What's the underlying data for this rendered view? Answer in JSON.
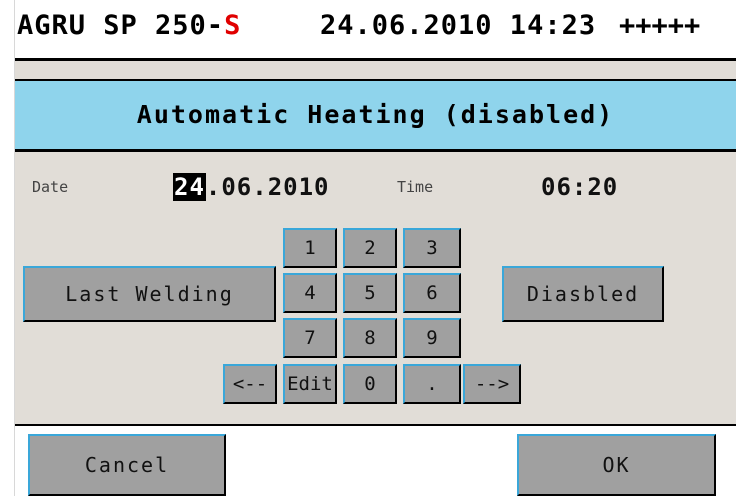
{
  "header": {
    "model_prefix": "AGRU SP 250-",
    "model_suffix": "S",
    "datetime": "24.06.2010 14:23",
    "signal": "+++++"
  },
  "screen": {
    "title": "Automatic Heating (disabled)"
  },
  "fields": {
    "date_label": "Date",
    "date_cursor": "24",
    "date_rest": ".06.2010",
    "time_label": "Time",
    "time_value": "06:20"
  },
  "buttons": {
    "last_welding": "Last Welding",
    "status_toggle": "Diasbled",
    "cancel": "Cancel",
    "ok": "OK"
  },
  "keypad": {
    "k1": "1",
    "k2": "2",
    "k3": "3",
    "k4": "4",
    "k5": "5",
    "k6": "6",
    "k7": "7",
    "k8": "8",
    "k9": "9",
    "back": "<--",
    "edit": "Edit",
    "k0": "0",
    "dot": ".",
    "forward": "-->"
  },
  "colors": {
    "title_bg": "#8fd4ec",
    "screen_bg": "#e1ddd7",
    "button_bg": "#a0a0a0",
    "accent_red": "#e00000"
  }
}
